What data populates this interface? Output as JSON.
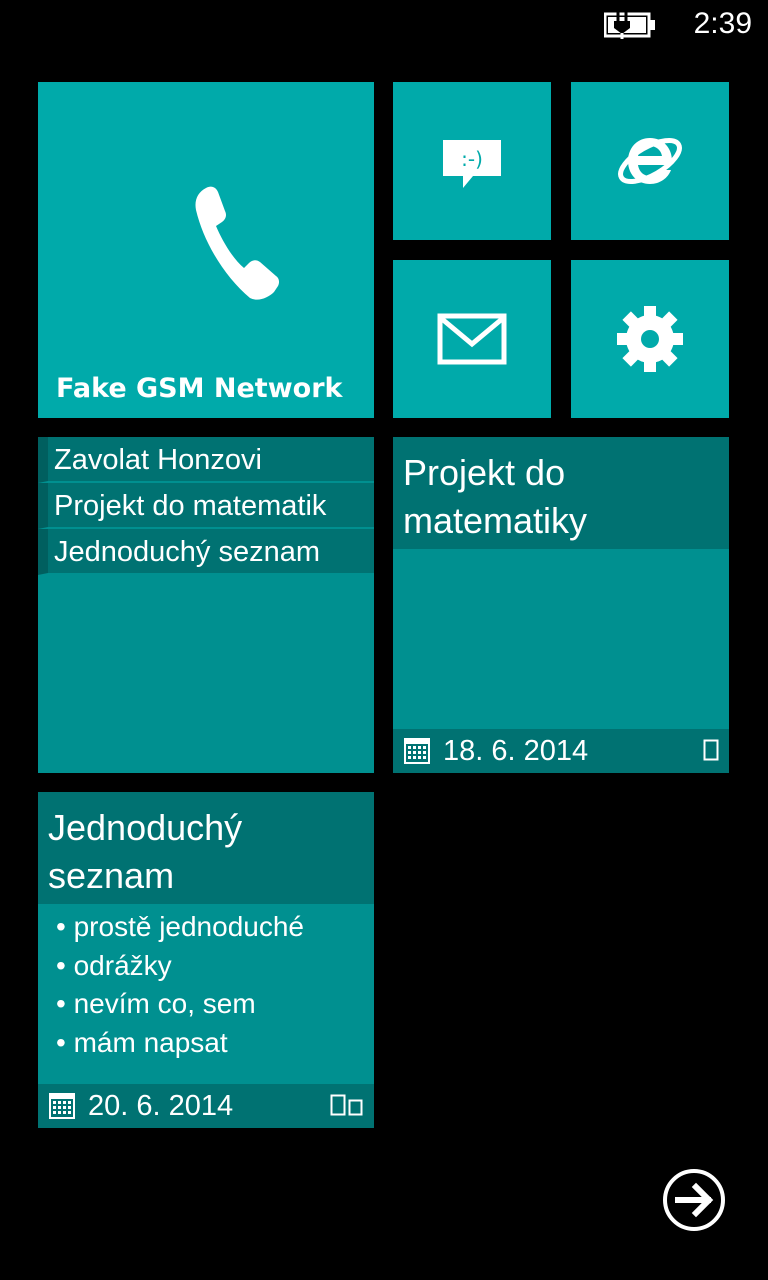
{
  "status_bar": {
    "time": "2:39",
    "battery_icon": "battery-charging-icon"
  },
  "tiles": {
    "phone": {
      "label": "Fake GSM Network",
      "icon": "phone-icon"
    },
    "messaging": {
      "icon": "messaging-icon",
      "emoticon": ":-)"
    },
    "internet_explorer": {
      "icon": "internet-explorer-icon"
    },
    "mail": {
      "icon": "mail-icon"
    },
    "settings": {
      "icon": "gear-icon"
    }
  },
  "note_list": {
    "items": [
      "Zavolat Honzovi",
      "Projekt do matematik",
      "Jednoduchý seznam"
    ]
  },
  "note_project": {
    "title": "Projekt do matematiky",
    "date": "18. 6. 2014",
    "page_indicator": "single"
  },
  "note_simple": {
    "title": "Jednoduchý seznam",
    "bullets": [
      "prostě jednoduché",
      "odrážky",
      "nevím co, sem",
      "mám napsat"
    ],
    "date": "20. 6. 2014",
    "page_indicator": "double"
  },
  "navigation": {
    "next_icon": "arrow-right-circle-icon"
  },
  "colors": {
    "accent": "#00aaaa",
    "note_body": "#009090",
    "note_header": "#007272",
    "list_marker": "#005f5f",
    "background": "#000000"
  }
}
